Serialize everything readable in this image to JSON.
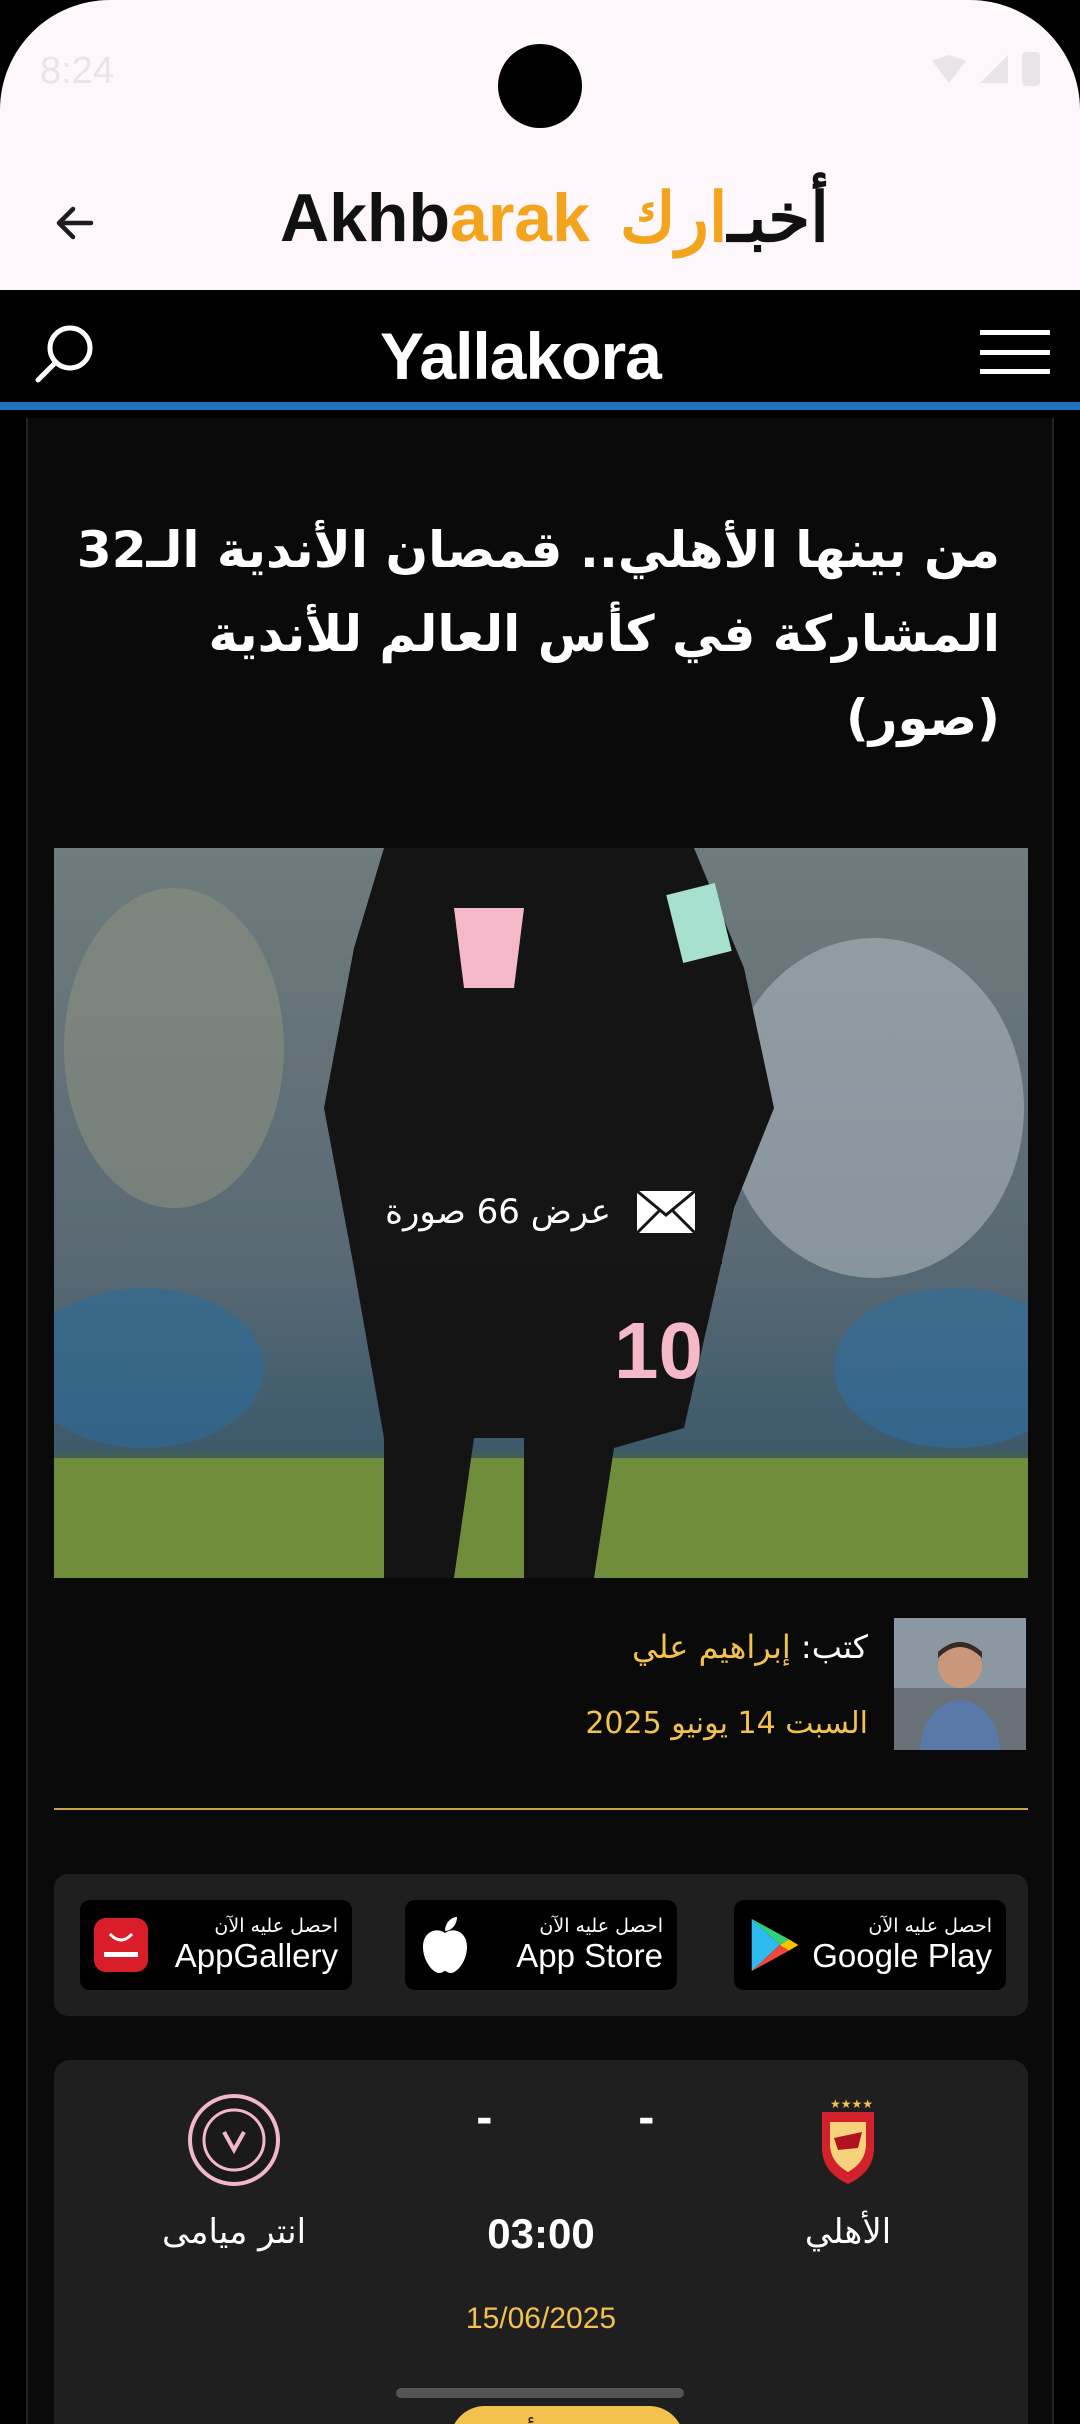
{
  "status_bar": {
    "time": "8:24"
  },
  "app_bar": {
    "logo_latin_dark": "Akhb",
    "logo_latin_accent": "arak",
    "logo_arabic_accent": "ارك",
    "logo_arabic_dark": "أخبـ"
  },
  "site": {
    "brand": "Yallakora"
  },
  "article": {
    "headline": "من بينها الأهلي.. قمصان الأندية الـ32 المشاركة في كأس العالم للأندية (صور)",
    "photo_button_label": "عرض 66 صورة",
    "author_prefix": "كتب:",
    "author_name": "إبراهيم علي",
    "date": "السبت 14 يونيو 2025"
  },
  "stores": [
    {
      "small": "احصل عليه الآن",
      "big": "Google Play",
      "icon": "google-play-icon"
    },
    {
      "small": "احصل عليه الآن",
      "big": "App Store",
      "icon": "apple-icon"
    },
    {
      "small": "احصل عليه الآن",
      "big": "AppGallery",
      "icon": "huawei-icon"
    }
  ],
  "match": {
    "home_team": "الأهلي",
    "away_team": "انتر ميامى",
    "home_score": "-",
    "away_score": "-",
    "time": "03:00",
    "date": "15/06/2025",
    "status": "لم تبدأ"
  },
  "colors": {
    "accent": "#f2a51c",
    "gold": "#f2c14e",
    "brand_blue": "#1e73be"
  }
}
